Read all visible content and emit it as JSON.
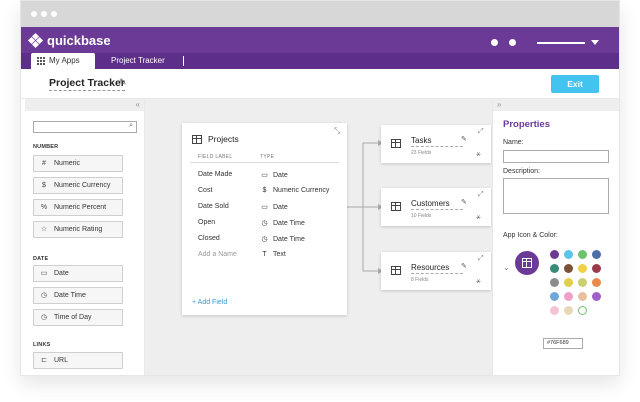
{
  "header": {
    "brand": "quickbase"
  },
  "tabs": {
    "my_apps": "My Apps",
    "project_tracker": "Project Tracker"
  },
  "toolbar": {
    "app_title": "Project Tracker",
    "exit_label": "Exit"
  },
  "left_panel": {
    "search_placeholder": "",
    "sections": {
      "number": "NUMBER",
      "date": "DATE",
      "links": "LINKS"
    },
    "number_fields": [
      "Numeric",
      "Numeric Currency",
      "Numeric Percent",
      "Numeric Rating"
    ],
    "date_fields": [
      "Date",
      "Date Time",
      "Time of Day"
    ],
    "link_fields": [
      "URL"
    ],
    "icons": {
      "numeric": "#",
      "currency": "$",
      "percent": "%",
      "rating": "☆",
      "date": "▭",
      "datetime": "◷",
      "time": "◷",
      "url": "⊏"
    }
  },
  "projects_card": {
    "title": "Projects",
    "col_label": "FIELD LABEL",
    "col_type": "TYPE",
    "fields": [
      {
        "name": "Date Made",
        "type": "Date",
        "icon": "▭"
      },
      {
        "name": "Cost",
        "type": "Numeric Currency",
        "icon": "$"
      },
      {
        "name": "Date Sold",
        "type": "Date",
        "icon": "▭"
      },
      {
        "name": "Open",
        "type": "Date Time",
        "icon": "◷"
      },
      {
        "name": "Closed",
        "type": "Date Time",
        "icon": "◷"
      },
      {
        "name": "Add a Name",
        "type": "Text",
        "icon": "T"
      }
    ],
    "add_field": "+ Add Field"
  },
  "related_tables": [
    {
      "title": "Tasks",
      "count": "23 Fields"
    },
    {
      "title": "Customers",
      "count": "10 Fields"
    },
    {
      "title": "Resources",
      "count": "8 Fields"
    }
  ],
  "properties": {
    "title": "Properties",
    "name_label": "Name:",
    "description_label": "Description:",
    "icon_color_label": "App Icon & Color:",
    "hex_value": "#76F689",
    "accent": "#6b3a97",
    "swatches": [
      "#6b3a97",
      "#5cc4e8",
      "#6cc36c",
      "#4a6fa8",
      "#3a8a7a",
      "#7a5234",
      "#f0d046",
      "#9a3a4a",
      "#8c8c8c",
      "#e0d04a",
      "#c8d070",
      "#e88a4a",
      "#6fa8d8",
      "#f0a0c8",
      "#e8c0a0",
      "#a060c8",
      "#f4c4d4",
      "#e8d8b8",
      "#ffffff"
    ]
  }
}
